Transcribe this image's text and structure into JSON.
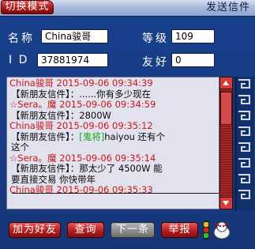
{
  "titlebar": {
    "mode_button": "切换模式",
    "title": "发送信件"
  },
  "profile": {
    "name_label": "名称",
    "name_value": "China骏哥",
    "level_label": "等级",
    "level_value": "109",
    "id_label": "I D",
    "id_value": "37881974",
    "friend_label": "友好",
    "friend_value": "0"
  },
  "messages": [
    {
      "sender": "China骏哥",
      "time": "2015-09-06 09:34:39",
      "tag": "【新朋友信件】：",
      "text": "......你有多少现在"
    },
    {
      "sender": "☆Sera。魔",
      "time": "2015-09-06 09:34:59",
      "tag": "【新朋友信件】：",
      "text": "2800W"
    },
    {
      "sender": "China骏哥",
      "time": "2015-09-06 09:35:12",
      "tag": "【新朋友信件】：",
      "highlight": "[鬼将]",
      "text_after": "haiyou 还有个",
      "text_line2": "这个"
    },
    {
      "sender": "☆Sera。魔",
      "time": "2015-09-06 09:35:14",
      "tag": "【新朋友信件】：",
      "text": "那太少了  4500W  能",
      "text_line2": "要直接交易  你快带年"
    },
    {
      "sender": "China骏哥",
      "time": "2015-09-06 09:35:33"
    }
  ],
  "buttons": {
    "add_friend": "加为好友",
    "query": "查询",
    "next": "下一条",
    "report": "举报"
  },
  "colors": {
    "accent_red": "#b01717",
    "sender_red": "#d11515",
    "highlight_green": "#14a514",
    "panel_bg": "#e1e2ee"
  },
  "icons": {
    "scroll_up": "scroll-up-arrow-icon",
    "scroll_down": "scroll-down-arrow-icon",
    "signal": "signal-light-icon",
    "pet": "pet-mascot-icon"
  }
}
